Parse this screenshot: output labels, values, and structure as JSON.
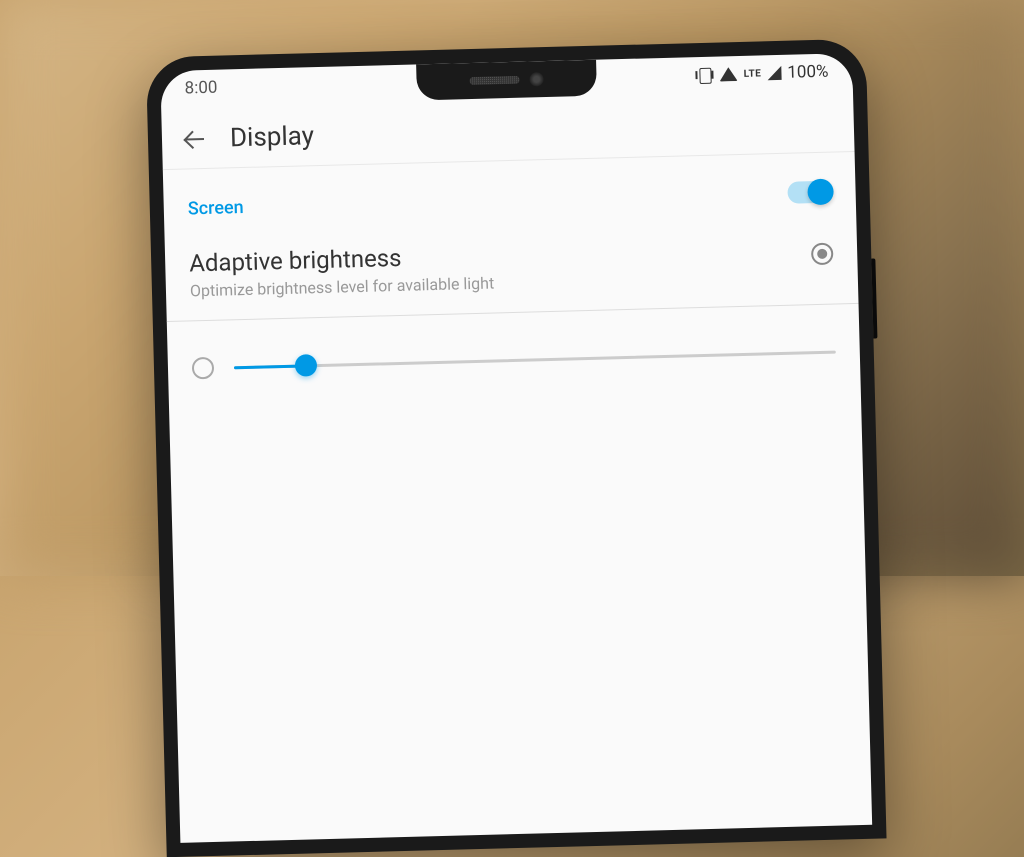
{
  "status_bar": {
    "time": "8:00",
    "lte_label": "LTE",
    "battery_percent": "100%"
  },
  "header": {
    "title": "Display"
  },
  "section": {
    "label": "Screen",
    "toggle_on": true
  },
  "settings": {
    "adaptive_brightness": {
      "title": "Adaptive brightness",
      "subtitle": "Optimize brightness level for available light"
    }
  },
  "slider": {
    "percent": 12
  },
  "colors": {
    "accent": "#0099e5"
  }
}
